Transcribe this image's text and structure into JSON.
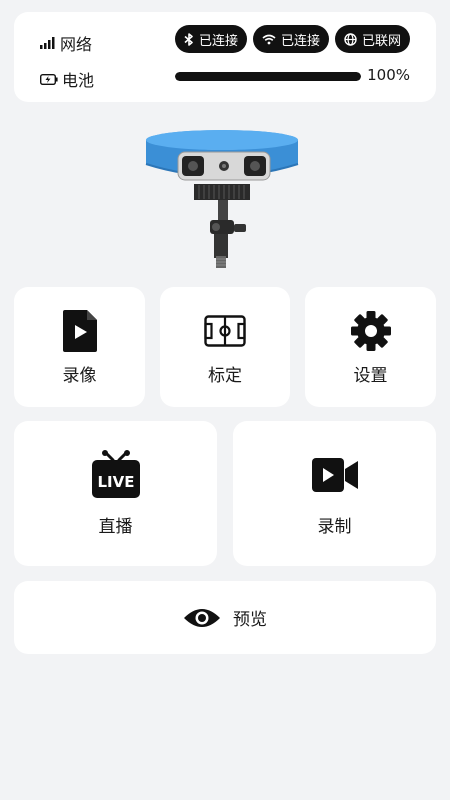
{
  "status": {
    "network_label": "网络",
    "battery_label": "电池",
    "pills": [
      {
        "icon": "bluetooth-icon",
        "label": "已连接"
      },
      {
        "icon": "wifi-icon",
        "label": "已连接"
      },
      {
        "icon": "globe-icon",
        "label": "已联网"
      }
    ],
    "battery_level": 100,
    "battery_text": "100%"
  },
  "tiles": {
    "record_video": {
      "icon": "video-file-icon",
      "label": "录像"
    },
    "calibrate": {
      "icon": "field-pitch-icon",
      "label": "标定"
    },
    "settings": {
      "icon": "gear-icon",
      "label": "设置"
    },
    "live": {
      "icon": "live-tv-icon",
      "label": "直播"
    },
    "record": {
      "icon": "video-camera-icon",
      "label": "录制"
    }
  },
  "preview": {
    "icon": "eye-icon",
    "label": "预览"
  },
  "colors": {
    "background": "#f2f3f5",
    "card": "#ffffff",
    "accent": "#111111",
    "device_blue": "#3b8fd6"
  }
}
